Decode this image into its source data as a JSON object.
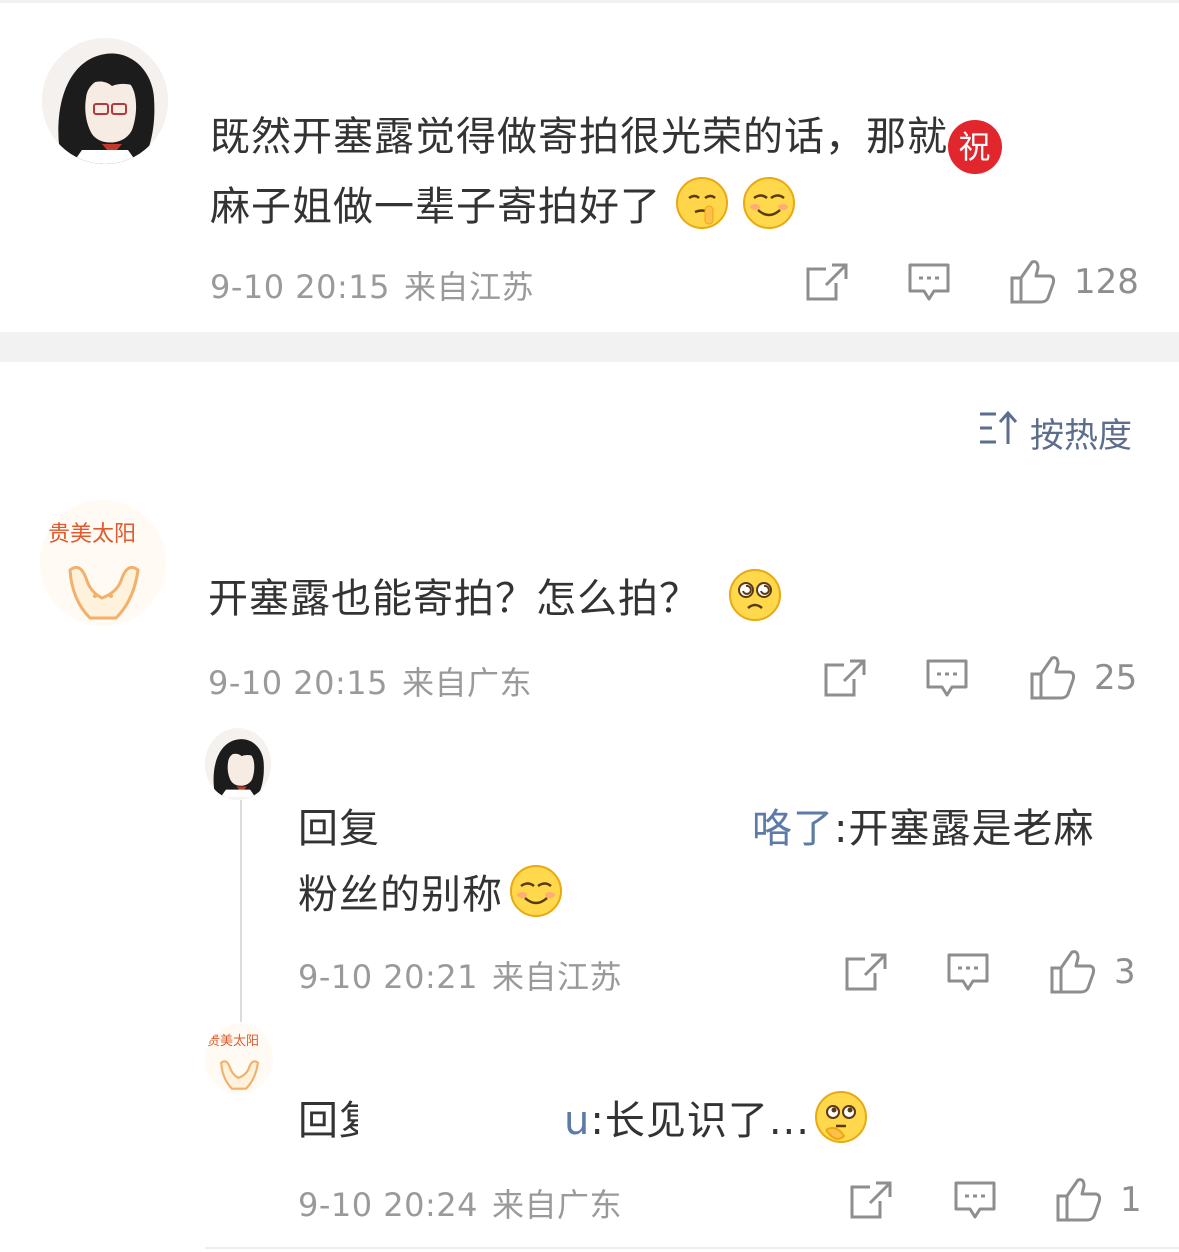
{
  "colors": {
    "text": "#333333",
    "meta": "#9a9a9a",
    "link": "#5d7ba6",
    "sort": "#5d6e8c",
    "separator": "#f2f2f2"
  },
  "top_comment": {
    "avatar": "anime-girl-avatar",
    "text_line1": "既然开塞露觉得做寄拍很光荣的话，那就",
    "text_line2": "麻子姐做一辈子寄拍好了",
    "badge": "祝",
    "emojis": [
      "shush-emoji",
      "smirk-emoji"
    ],
    "time": "9-10 20:15",
    "location": "来自江苏",
    "likes": "128"
  },
  "sort": {
    "icon": "sort-icon",
    "label": "按热度"
  },
  "comment": {
    "avatar_text": "贵美太阳",
    "text": "开塞露也能寄拍？怎么拍？",
    "emoji": "dizzy-eyes-emoji",
    "time": "9-10 20:15",
    "location": "来自广东",
    "likes": "25"
  },
  "reply1": {
    "prefix": "回复",
    "mention_tail": "咯了",
    "text_a": ":开塞露是老麻",
    "text_b": "粉丝的别称",
    "emoji": "smirk-emoji",
    "time": "9-10 20:21",
    "location": "来自江苏",
    "likes": "3"
  },
  "reply2": {
    "avatar_text": "贵美太阳",
    "prefix": "回复",
    "mention_tail": "u",
    "text": ":长见识了...",
    "emoji": "thinking-emoji",
    "time": "9-10 20:24",
    "location": "来自广东",
    "likes": "1"
  }
}
